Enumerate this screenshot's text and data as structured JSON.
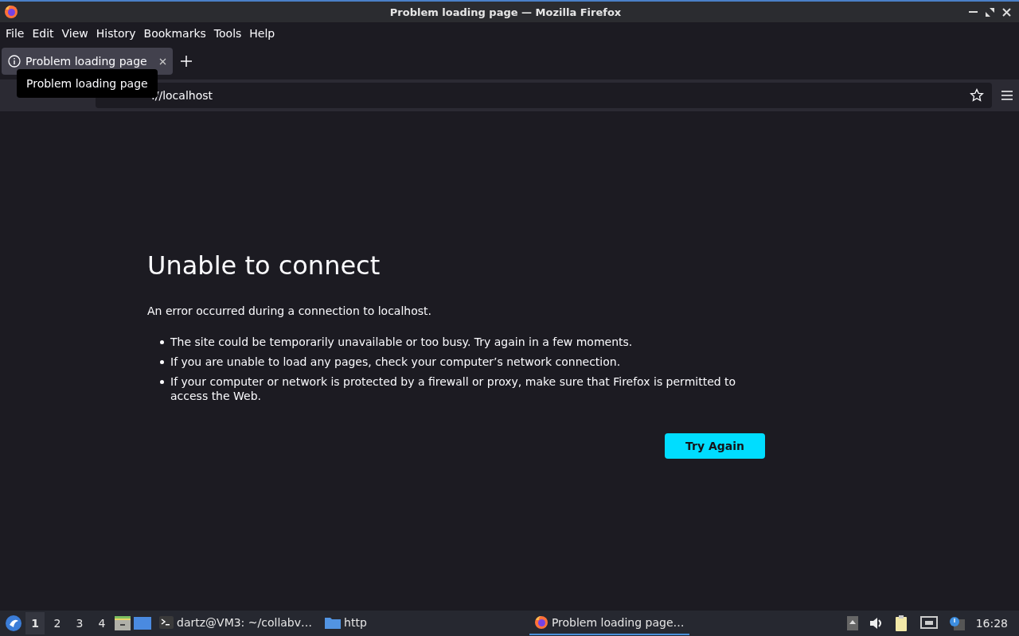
{
  "window": {
    "title": "Problem loading page — Mozilla Firefox"
  },
  "menu": [
    "File",
    "Edit",
    "View",
    "History",
    "Bookmarks",
    "Tools",
    "Help"
  ],
  "tabs": [
    {
      "label": "Problem loading page",
      "selected": true
    }
  ],
  "tooltip": "Problem loading page",
  "address_bar": {
    "value": "://localhost"
  },
  "error": {
    "heading": "Unable to connect",
    "intro": "An error occurred during a connection to localhost.",
    "bullets": [
      "The site could be temporarily unavailable or too busy. Try again in a few moments.",
      "If you are unable to load any pages, check your computer’s network connection.",
      "If your computer or network is protected by a firewall or proxy, make sure that Firefox is permitted to access the Web."
    ],
    "button": "Try Again"
  },
  "taskbar": {
    "workspaces": [
      {
        "label": "1",
        "selected": true
      },
      {
        "label": "2",
        "selected": false
      },
      {
        "label": "3",
        "selected": false
      },
      {
        "label": "4",
        "selected": false
      }
    ],
    "tasks": [
      {
        "kind": "terminal",
        "label": "dartz@VM3: ~/collabv…",
        "selected": false
      },
      {
        "kind": "folder",
        "label": "http",
        "selected": false
      },
      {
        "kind": "browser",
        "label": "Problem loading page…",
        "selected": true
      }
    ],
    "clock": "16:28"
  }
}
